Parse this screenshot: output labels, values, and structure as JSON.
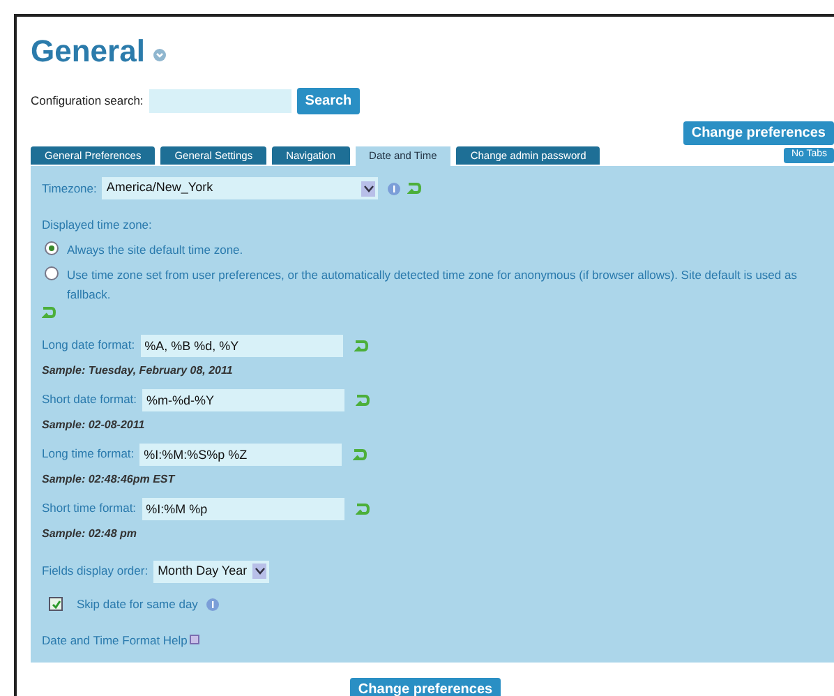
{
  "title": "General",
  "search": {
    "label": "Configuration search:",
    "button": "Search"
  },
  "top_button": "Change preferences",
  "tabs": [
    {
      "label": "General Preferences",
      "selected": false
    },
    {
      "label": "General Settings",
      "selected": false
    },
    {
      "label": "Navigation",
      "selected": false
    },
    {
      "label": "Date and Time",
      "selected": true
    },
    {
      "label": "Change admin password",
      "selected": false
    }
  ],
  "no_tabs_button": "No Tabs",
  "timezone": {
    "label": "Timezone:",
    "value": "America/New_York"
  },
  "displayed_time_zone": {
    "label": "Displayed time zone:",
    "options": [
      {
        "label": "Always the site default time zone.",
        "selected": true
      },
      {
        "label": "Use time zone set from user preferences, or the automatically detected time zone for anonymous (if browser allows). Site default is used as fallback.",
        "selected": false
      }
    ]
  },
  "formats": [
    {
      "label": "Long date format:",
      "value": "%A, %B %d, %Y",
      "sample": "Sample: Tuesday, February 08, 2011"
    },
    {
      "label": "Short date format:",
      "value": "%m-%d-%Y",
      "sample": "Sample: 02-08-2011"
    },
    {
      "label": "Long time format:",
      "value": "%I:%M:%S%p %Z",
      "sample": "Sample: 02:48:46pm EST"
    },
    {
      "label": "Short time format:",
      "value": "%I:%M %p",
      "sample": "Sample: 02:48 pm"
    }
  ],
  "fields_display_order": {
    "label": "Fields display order:",
    "value": "Month Day Year"
  },
  "skip_date": {
    "label": "Skip date for same day",
    "checked": true
  },
  "help_link": "Date and Time Format Help",
  "bottom_button": "Change preferences"
}
